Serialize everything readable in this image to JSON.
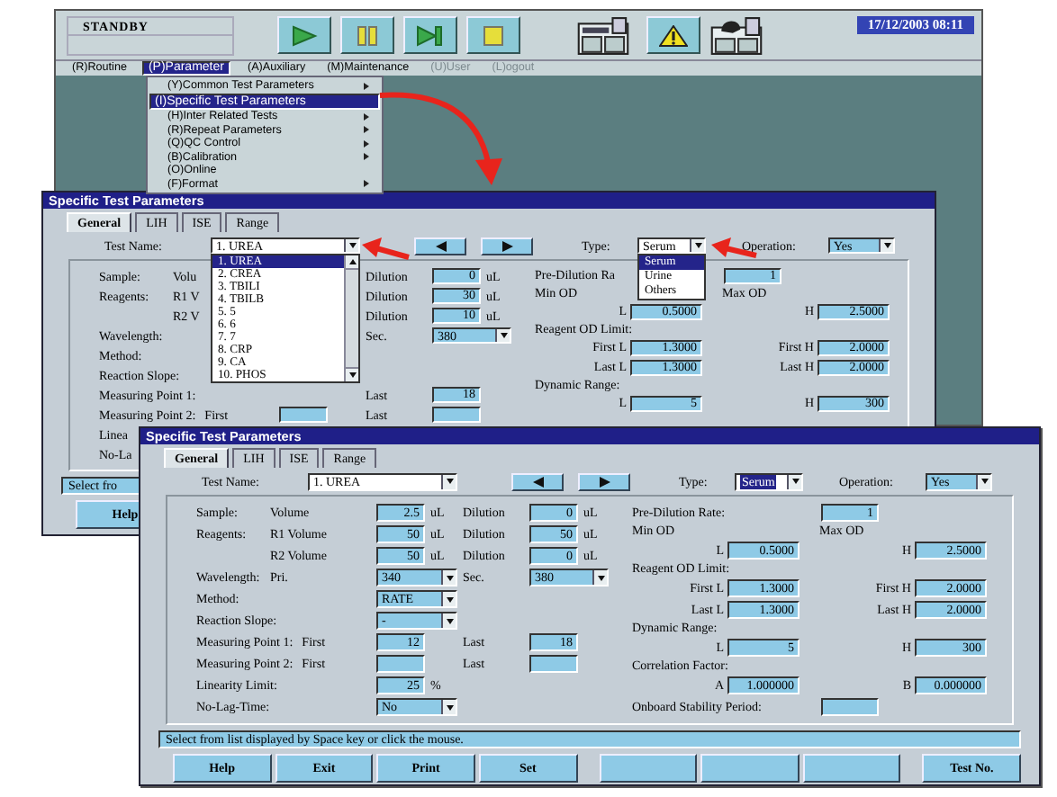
{
  "app": {
    "status": "STANDBY",
    "date": "17/12/2003 08:11",
    "toolbar": [
      {
        "kind": "play"
      },
      {
        "kind": "pause"
      },
      {
        "kind": "step"
      },
      {
        "kind": "stop"
      },
      {
        "kind": "analyzer"
      },
      {
        "kind": "warning"
      },
      {
        "kind": "instrument"
      }
    ],
    "menubar": [
      {
        "label": "(R)Routine",
        "selected": false,
        "disabled": false
      },
      {
        "label": "(P)Parameter",
        "selected": true,
        "disabled": false
      },
      {
        "label": "(A)Auxiliary",
        "selected": false,
        "disabled": false
      },
      {
        "label": "(M)Maintenance",
        "selected": false,
        "disabled": false
      },
      {
        "label": "(U)User",
        "selected": false,
        "disabled": true
      },
      {
        "label": "(L)ogout",
        "selected": false,
        "disabled": true
      }
    ],
    "menu": [
      {
        "label": "(Y)Common Test Parameters",
        "selected": false,
        "submenu": true
      },
      {
        "label": "(I)Specific Test Parameters",
        "selected": true,
        "submenu": false
      },
      {
        "label": "(H)Inter Related Tests",
        "selected": false,
        "submenu": true
      },
      {
        "label": "(R)Repeat Parameters",
        "selected": false,
        "submenu": true
      },
      {
        "label": "(Q)QC Control",
        "selected": false,
        "submenu": true
      },
      {
        "label": "(B)Calibration",
        "selected": false,
        "submenu": true
      },
      {
        "label": "(O)Online",
        "selected": false,
        "submenu": false
      },
      {
        "label": "(F)Format",
        "selected": false,
        "submenu": true
      }
    ]
  },
  "windows": [
    {
      "title": "Specific Test Parameters",
      "tabs": [
        {
          "label": "General",
          "selected": true
        },
        {
          "label": "LIH",
          "selected": false
        },
        {
          "label": "ISE",
          "selected": false
        },
        {
          "label": "Range",
          "selected": false
        }
      ],
      "test_name": {
        "label": "Test Name:",
        "value": "1. UREA",
        "options": [
          {
            "label": "1. UREA",
            "selected": true
          },
          {
            "label": "2. CREA",
            "selected": false
          },
          {
            "label": "3. TBILI",
            "selected": false
          },
          {
            "label": "4. TBILB",
            "selected": false
          },
          {
            "label": "5. 5",
            "selected": false
          },
          {
            "label": "6. 6",
            "selected": false
          },
          {
            "label": "7. 7",
            "selected": false
          },
          {
            "label": "8. CRP",
            "selected": false
          },
          {
            "label": "9. CA",
            "selected": false
          },
          {
            "label": "10. PHOS",
            "selected": false
          }
        ]
      },
      "type": {
        "label": "Type:",
        "value": "Serum",
        "highlighted": false,
        "options": [
          {
            "label": "Serum",
            "selected": true
          },
          {
            "label": "Urine",
            "selected": false
          },
          {
            "label": "Others",
            "selected": false
          }
        ]
      },
      "operation": {
        "label": "Operation:",
        "value": "Yes"
      },
      "left_rows": [
        {
          "label": "Sample:",
          "sub": "Volu",
          "label2": "Dilution",
          "input2": {
            "kind": "field",
            "value": "0"
          },
          "unit2": "uL"
        },
        {
          "label": "Reagents:",
          "sub": "R1 V",
          "label2": "Dilution",
          "input2": {
            "kind": "field",
            "value": "30"
          },
          "unit2": "uL"
        },
        {
          "sub": "R2 V",
          "label2": "Dilution",
          "input2": {
            "kind": "field",
            "value": "10"
          },
          "unit2": "uL"
        },
        {
          "label": "Wavelength:",
          "label2": "Sec.",
          "input2": {
            "kind": "select",
            "value": "380"
          }
        },
        {
          "label": "Method:"
        },
        {
          "label": "Reaction Slope:"
        },
        {
          "label": "Measuring Point 1:",
          "label2": "Last",
          "input2": {
            "kind": "field",
            "value": "18"
          }
        },
        {
          "label": "Measuring Point 2:",
          "sub": "First",
          "input": {
            "kind": "field"
          },
          "label2": "Last",
          "input2": {
            "kind": "field"
          }
        },
        {
          "label": "Linea"
        },
        {
          "label": "No-La"
        }
      ],
      "right_rows": [
        {
          "kind": "single",
          "label": "Pre-Dilution Ra",
          "value": "1"
        },
        {
          "kind": "heading",
          "text": "Min OD",
          "text2": "Max OD"
        },
        {
          "kind": "pair",
          "label": "L",
          "value": "0.5000",
          "label2": "H",
          "value2": "2.5000"
        },
        {
          "kind": "heading",
          "text": "Reagent OD Limit:"
        },
        {
          "kind": "pair",
          "label": "First L",
          "value": "1.3000",
          "label2": "First H",
          "value2": "2.0000"
        },
        {
          "kind": "pair",
          "label": "Last L",
          "value": "1.3000",
          "label2": "Last H",
          "value2": "2.0000"
        },
        {
          "kind": "heading",
          "text": "Dynamic Range:"
        },
        {
          "kind": "pair",
          "label": "L",
          "value": "5",
          "label2": "H",
          "value2": "300"
        }
      ],
      "status": "Select fro",
      "buttons": [
        {
          "kind": "button",
          "label": "Help"
        }
      ]
    },
    {
      "title": "Specific Test Parameters",
      "tabs": [
        {
          "label": "General",
          "selected": true
        },
        {
          "label": "LIH",
          "selected": false
        },
        {
          "label": "ISE",
          "selected": false
        },
        {
          "label": "Range",
          "selected": false
        }
      ],
      "test_name": {
        "label": "Test Name:",
        "value": "1. UREA"
      },
      "type": {
        "label": "Type:",
        "value": "Serum",
        "highlighted": true
      },
      "operation": {
        "label": "Operation:",
        "value": "Yes"
      },
      "left_rows": [
        {
          "label": "Sample:",
          "sub": "Volume",
          "input": {
            "kind": "field",
            "value": "2.5"
          },
          "unit": "uL",
          "label2": "Dilution",
          "input2": {
            "kind": "field",
            "value": "0"
          },
          "unit2": "uL"
        },
        {
          "label": "Reagents:",
          "sub": "R1 Volume",
          "input": {
            "kind": "field",
            "value": "50"
          },
          "unit": "uL",
          "label2": "Dilution",
          "input2": {
            "kind": "field",
            "value": "50"
          },
          "unit2": "uL"
        },
        {
          "sub": "R2 Volume",
          "input": {
            "kind": "field",
            "value": "50"
          },
          "unit": "uL",
          "label2": "Dilution",
          "input2": {
            "kind": "field",
            "value": "0"
          },
          "unit2": "uL"
        },
        {
          "label": "Wavelength:",
          "sub": "Pri.",
          "input": {
            "kind": "select",
            "value": "340"
          },
          "label2": "Sec.",
          "input2": {
            "kind": "select",
            "value": "380"
          }
        },
        {
          "label": "Method:",
          "input": {
            "kind": "select",
            "value": "RATE"
          }
        },
        {
          "label": "Reaction Slope:",
          "input": {
            "kind": "select",
            "value": "-"
          }
        },
        {
          "label": "Measuring Point 1:",
          "sub": "First",
          "input": {
            "kind": "field",
            "value": "12"
          },
          "label2": "Last",
          "input2": {
            "kind": "field",
            "value": "18"
          }
        },
        {
          "label": "Measuring Point 2:",
          "sub": "First",
          "input": {
            "kind": "field"
          },
          "label2": "Last",
          "input2": {
            "kind": "field"
          }
        },
        {
          "label": "Linearity Limit:",
          "input": {
            "kind": "field",
            "value": "25"
          },
          "unit": "%"
        },
        {
          "label": "No-Lag-Time:",
          "input": {
            "kind": "select",
            "value": "No"
          }
        }
      ],
      "right_rows": [
        {
          "kind": "single",
          "label": "Pre-Dilution Rate:",
          "value": "1"
        },
        {
          "kind": "heading",
          "text": "Min OD",
          "text2": "Max OD"
        },
        {
          "kind": "pair",
          "label": "L",
          "value": "0.5000",
          "label2": "H",
          "value2": "2.5000"
        },
        {
          "kind": "heading",
          "text": "Reagent OD Limit:"
        },
        {
          "kind": "pair",
          "label": "First L",
          "value": "1.3000",
          "label2": "First H",
          "value2": "2.0000"
        },
        {
          "kind": "pair",
          "label": "Last L",
          "value": "1.3000",
          "label2": "Last H",
          "value2": "2.0000"
        },
        {
          "kind": "heading",
          "text": "Dynamic Range:"
        },
        {
          "kind": "pair",
          "label": "L",
          "value": "5",
          "label2": "H",
          "value2": "300"
        },
        {
          "kind": "heading",
          "text": "Correlation Factor:"
        },
        {
          "kind": "pair",
          "label": "A",
          "value": "1.000000",
          "label2": "B",
          "value2": "0.000000"
        },
        {
          "kind": "single",
          "label": "Onboard Stability Period:"
        }
      ],
      "status": "Select from list displayed by Space key or click the mouse.",
      "buttons": [
        {
          "kind": "button",
          "label": "Help"
        },
        {
          "kind": "button",
          "label": "Exit"
        },
        {
          "kind": "button",
          "label": "Print"
        },
        {
          "kind": "button",
          "label": "Set"
        },
        {
          "kind": "blank"
        },
        {
          "kind": "blank"
        },
        {
          "kind": "blank"
        },
        {
          "kind": "button",
          "label": "Test No."
        }
      ]
    }
  ]
}
